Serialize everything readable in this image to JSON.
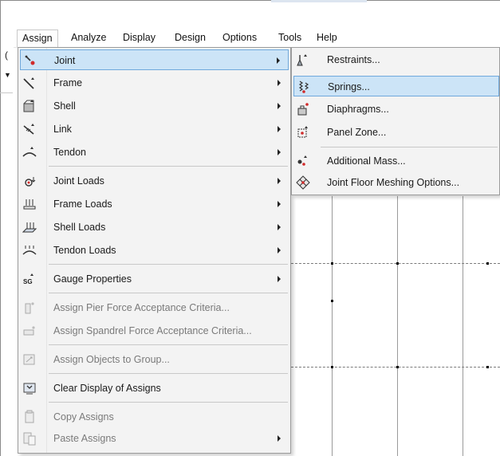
{
  "menubar": {
    "items": [
      {
        "label": "Assign",
        "active": true
      },
      {
        "label": "Analyze"
      },
      {
        "label": "Display"
      },
      {
        "label": "Design"
      },
      {
        "label": "Options"
      },
      {
        "label": "Tools"
      },
      {
        "label": "Help"
      }
    ]
  },
  "background": {
    "left_glyph_1": "(",
    "left_glyph_2": "▼"
  },
  "assign_menu": {
    "items": [
      {
        "label": "Joint",
        "icon": "joint-icon",
        "submenu": true,
        "highlighted": true
      },
      {
        "label": "Frame",
        "icon": "frame-icon",
        "submenu": true
      },
      {
        "label": "Shell",
        "icon": "shell-icon",
        "submenu": true
      },
      {
        "label": "Link",
        "icon": "link-icon",
        "submenu": true
      },
      {
        "label": "Tendon",
        "icon": "tendon-icon",
        "submenu": true
      },
      {
        "label": "Joint Loads",
        "icon": "joint-loads-icon",
        "submenu": true
      },
      {
        "label": "Frame Loads",
        "icon": "frame-loads-icon",
        "submenu": true
      },
      {
        "label": "Shell Loads",
        "icon": "shell-loads-icon",
        "submenu": true
      },
      {
        "label": "Tendon Loads",
        "icon": "tendon-loads-icon",
        "submenu": true
      },
      {
        "label": "Gauge Properties",
        "icon": "gauge-properties-icon",
        "icon_text": "SG",
        "submenu": true
      },
      {
        "label": "Assign Pier Force Acceptance Criteria...",
        "icon": "pier-criteria-icon",
        "disabled": true
      },
      {
        "label": "Assign Spandrel Force Acceptance Criteria...",
        "icon": "spandrel-criteria-icon",
        "disabled": true
      },
      {
        "label": "Assign Objects to Group...",
        "icon": "group-icon",
        "disabled": true
      },
      {
        "label": "Clear Display of Assigns",
        "icon": "clear-display-icon"
      },
      {
        "label": "Copy Assigns",
        "icon": "copy-assigns-icon",
        "disabled": true
      },
      {
        "label": "Paste Assigns",
        "icon": "paste-assigns-icon",
        "disabled": true,
        "submenu": true
      }
    ]
  },
  "joint_submenu": {
    "items": [
      {
        "label": "Restraints...",
        "icon": "restraints-icon"
      },
      {
        "label": "Springs...",
        "icon": "springs-icon",
        "highlighted": true
      },
      {
        "label": "Diaphragms...",
        "icon": "diaphragms-icon"
      },
      {
        "label": "Panel Zone...",
        "icon": "panel-zone-icon"
      },
      {
        "label": "Additional Mass...",
        "icon": "additional-mass-icon"
      },
      {
        "label": "Joint Floor Meshing Options...",
        "icon": "floor-meshing-icon"
      }
    ]
  },
  "colors": {
    "highlight_bg": "#cce4f7",
    "highlight_border": "#6fa8dc",
    "menu_bg": "#f3f3f3",
    "disabled_text": "#7a7a7a",
    "icon_accent": "#d12a2a"
  }
}
